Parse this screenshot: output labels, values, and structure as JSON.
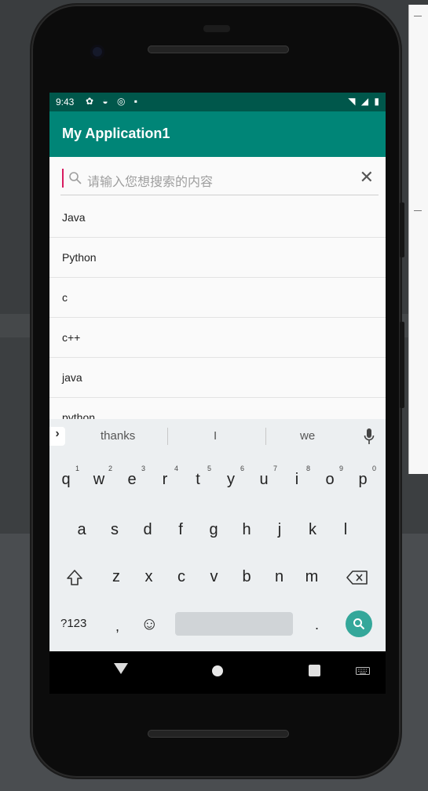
{
  "status_bar": {
    "time": "9:43",
    "left_icons": "✿ ◒ ◎ ▪",
    "right_icons": "◥ ◢ ▮"
  },
  "app_bar": {
    "title": "My Application1"
  },
  "search": {
    "placeholder": "请输入您想搜索的内容",
    "clear_label": "✕"
  },
  "list_items": [
    "Java",
    "Python",
    "c",
    "c++",
    "java",
    "python"
  ],
  "keyboard": {
    "suggestions": [
      "thanks",
      "I",
      "we"
    ],
    "expand_label": "›",
    "row1": [
      {
        "key": "q",
        "hint": "1"
      },
      {
        "key": "w",
        "hint": "2"
      },
      {
        "key": "e",
        "hint": "3"
      },
      {
        "key": "r",
        "hint": "4"
      },
      {
        "key": "t",
        "hint": "5"
      },
      {
        "key": "y",
        "hint": "6"
      },
      {
        "key": "u",
        "hint": "7"
      },
      {
        "key": "i",
        "hint": "8"
      },
      {
        "key": "o",
        "hint": "9"
      },
      {
        "key": "p",
        "hint": "0"
      }
    ],
    "row2": [
      "a",
      "s",
      "d",
      "f",
      "g",
      "h",
      "j",
      "k",
      "l"
    ],
    "row3": [
      "z",
      "x",
      "c",
      "v",
      "b",
      "n",
      "m"
    ],
    "symbols_label": "?123",
    "comma_label": ",",
    "emoji_label": "☺",
    "period_label": "."
  },
  "colors": {
    "status_bar": "#00574b",
    "app_bar": "#008577",
    "accent": "#d81b60",
    "search_key": "#34a79a"
  }
}
